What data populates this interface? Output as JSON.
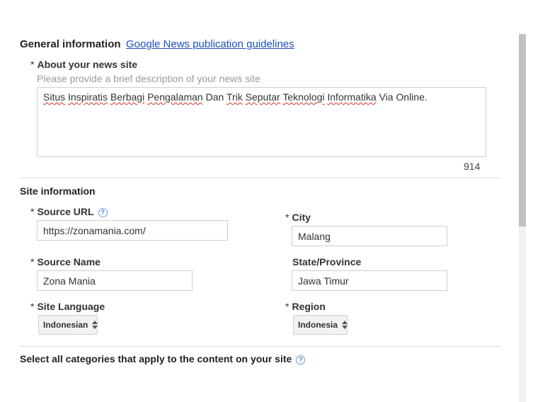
{
  "general": {
    "title": "General information",
    "guidelines_link": "Google News publication guidelines",
    "about_label": "About your news site",
    "about_hint": "Please provide a brief description of your news site",
    "about_words": [
      "Situs",
      "Inspiratis",
      "Berbagi",
      "Pengalaman",
      "Dan",
      "Trik",
      "Seputar",
      "Teknologi",
      "Informatika",
      "Via",
      "Online."
    ],
    "about_counter": "914"
  },
  "site": {
    "title": "Site information",
    "source_url_label": "Source URL",
    "source_url_value": "https://zonamania.com/",
    "source_name_label": "Source Name",
    "source_name_value": "Zona Mania",
    "language_label": "Site Language",
    "language_value": "Indonesian",
    "city_label": "City",
    "city_value": "Malang",
    "state_label": "State/Province",
    "state_value": "Jawa Timur",
    "region_label": "Region",
    "region_value": "Indonesia"
  },
  "categories": {
    "title": "Select all categories that apply to the content on your site"
  },
  "required_marker": "*",
  "help_glyph": "?",
  "icons": {
    "help": "help-circle-icon",
    "select_arrows": "up-down-arrows-icon"
  },
  "colors": {
    "link": "#1a4fbf",
    "help": "#4a7fd0",
    "spellcheck": "#d93025"
  }
}
